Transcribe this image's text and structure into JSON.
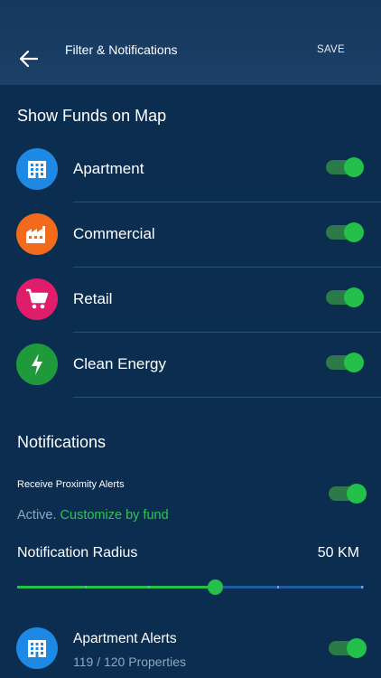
{
  "header": {
    "title": "Filter & Notifications",
    "save_label": "SAVE",
    "back_icon": "arrow-left-icon"
  },
  "funds": {
    "title": "Show Funds on Map",
    "items": [
      {
        "label": "Apartment",
        "icon": "apartment-building-icon",
        "color": "#1e88e5",
        "enabled": true
      },
      {
        "label": "Commercial",
        "icon": "factory-icon",
        "color": "#f26b1d",
        "enabled": true
      },
      {
        "label": "Retail",
        "icon": "shopping-cart-icon",
        "color": "#e01d6a",
        "enabled": true
      },
      {
        "label": "Clean Energy",
        "icon": "lightning-bolt-icon",
        "color": "#1f9a3a",
        "enabled": true
      }
    ]
  },
  "notifications": {
    "title": "Notifications",
    "proximity_label": "Receive Proximity Alerts",
    "proximity_enabled": true,
    "status_active": "Active.",
    "status_link": "Customize by fund",
    "radius_label": "Notification Radius",
    "radius_value": "50 KM",
    "radius_fraction": 0.57
  },
  "alerts": {
    "items": [
      {
        "label": "Apartment Alerts",
        "subtitle": "119 / 120 Properties",
        "icon": "apartment-building-icon",
        "color": "#1e88e5",
        "enabled": true
      }
    ]
  },
  "colors": {
    "background": "#0b2d4f",
    "accent_green": "#23c14a",
    "toggle_track": "#2c7a48",
    "slider_track": "#1f5aa0"
  }
}
